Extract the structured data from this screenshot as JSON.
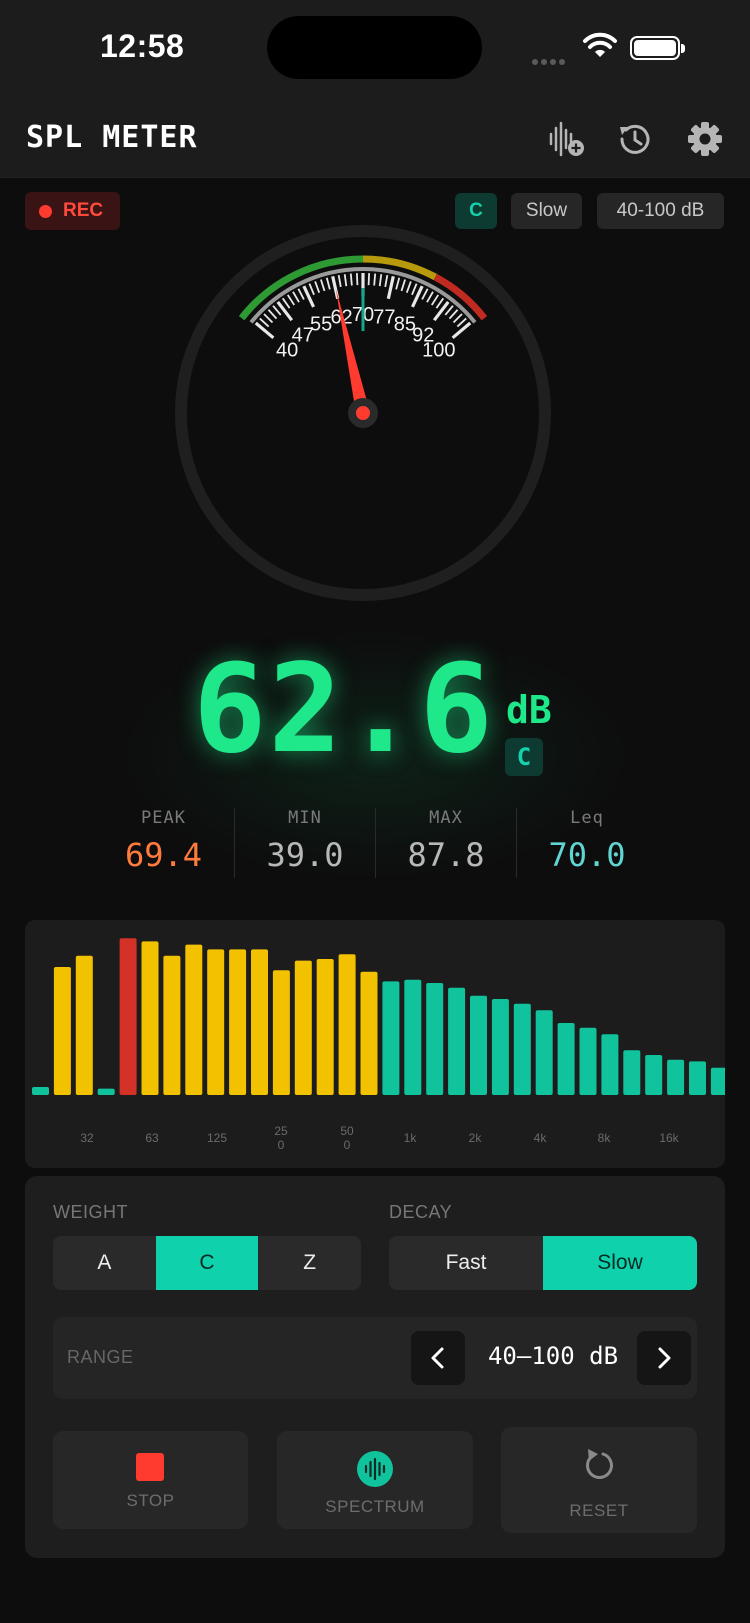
{
  "status_bar": {
    "time": "12:58"
  },
  "header": {
    "title": "SPL METER",
    "icons": [
      "waveform-add-icon",
      "history-icon",
      "gear-icon"
    ]
  },
  "chips": {
    "rec_label": "REC",
    "weighting": "C",
    "decay": "Slow",
    "range": "40-100 dB"
  },
  "gauge": {
    "scale_labels": [
      "40",
      "47",
      "55",
      "62",
      "70",
      "77",
      "85",
      "92",
      "100"
    ],
    "scale_min": 40,
    "scale_max": 100,
    "needle_value": 62.6,
    "marker_value": 70.0,
    "zone_colors": {
      "green": "#2e9a34",
      "yellow": "#b79a0c",
      "red": "#c12a20"
    },
    "needle_color": "#ff3b30"
  },
  "readout": {
    "value": "62.6",
    "unit": "dB",
    "weighting": "C"
  },
  "stats": [
    {
      "label": "PEAK",
      "value": "69.4",
      "color": "#ff7a3d"
    },
    {
      "label": "MIN",
      "value": "39.0",
      "color": "#b8b8b8"
    },
    {
      "label": "MAX",
      "value": "87.8",
      "color": "#b8b8b8"
    },
    {
      "label": "Leq",
      "value": "70.0",
      "color": "#5fd6d2"
    }
  ],
  "chart_data": {
    "type": "bar",
    "x_tick_labels": [
      "32",
      "63",
      "125",
      "25\n0",
      "50\n0",
      "1k",
      "2k",
      "4k",
      "8k",
      "16k"
    ],
    "levels": [
      5,
      80,
      87,
      4,
      98,
      96,
      87,
      94,
      91,
      91,
      91,
      78,
      84,
      85,
      88,
      77,
      71,
      72,
      70,
      67,
      62,
      60,
      57,
      53,
      45,
      42,
      38,
      28,
      25,
      22,
      21,
      17
    ],
    "bar_colors": [
      "teal",
      "yellow",
      "yellow",
      "teal",
      "red",
      "yellow",
      "yellow",
      "yellow",
      "yellow",
      "yellow",
      "yellow",
      "yellow",
      "yellow",
      "yellow",
      "yellow",
      "yellow",
      "teal",
      "teal",
      "teal",
      "teal",
      "teal",
      "teal",
      "teal",
      "teal",
      "teal",
      "teal",
      "teal",
      "teal",
      "teal",
      "teal",
      "teal",
      "teal"
    ],
    "palette": {
      "teal": "#10c39c",
      "yellow": "#f2c200",
      "red": "#d43226"
    }
  },
  "controls": {
    "weight_label": "WEIGHT",
    "weight_options": [
      "A",
      "C",
      "Z"
    ],
    "weight_selected": "C",
    "decay_label": "DECAY",
    "decay_options": [
      "Fast",
      "Slow"
    ],
    "decay_selected": "Slow",
    "range_label": "RANGE",
    "range_value": "40–100 dB",
    "stop_label": "STOP",
    "spectrum_label": "SPECTRUM",
    "reset_label": "RESET"
  }
}
